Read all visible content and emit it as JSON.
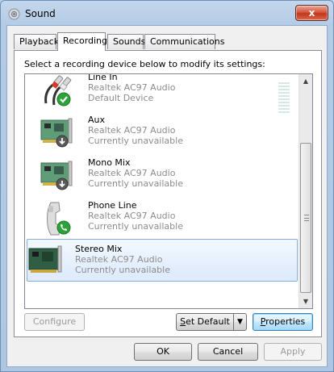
{
  "window": {
    "title": "Sound",
    "close_label": "x"
  },
  "tabs": [
    {
      "label": "Playback",
      "active": false
    },
    {
      "label": "Recording",
      "active": true
    },
    {
      "label": "Sounds",
      "active": false
    },
    {
      "label": "Communications",
      "active": false
    }
  ],
  "panel": {
    "instruction": "Select a recording device below to modify its settings:"
  },
  "devices": [
    {
      "name": "Line In",
      "driver": "Realtek AC97 Audio",
      "status": "Default Device",
      "icon": "line-in-cable-icon",
      "badge": "default-check-icon",
      "selected": false
    },
    {
      "name": "Aux",
      "driver": "Realtek AC97 Audio",
      "status": "Currently unavailable",
      "icon": "sound-card-icon",
      "badge": "unavailable-arrow-icon",
      "selected": false
    },
    {
      "name": "Mono Mix",
      "driver": "Realtek AC97 Audio",
      "status": "Currently unavailable",
      "icon": "sound-card-icon",
      "badge": "unavailable-arrow-icon",
      "selected": false
    },
    {
      "name": "Phone Line",
      "driver": "Realtek AC97 Audio",
      "status": "Currently unavailable",
      "icon": "telephone-handset-icon",
      "badge": "phone-badge-icon",
      "selected": false
    },
    {
      "name": "Stereo Mix",
      "driver": "Realtek AC97 Audio",
      "status": "Currently unavailable",
      "icon": "sound-card-icon",
      "badge": "",
      "selected": true
    }
  ],
  "buttons": {
    "configure": "Configure",
    "set_default_first": "S",
    "set_default_rest": "et Default",
    "set_default_arrow": "▼",
    "properties_first": "P",
    "properties_rest": "roperties",
    "ok": "OK",
    "cancel": "Cancel",
    "apply": "Apply"
  },
  "colors": {
    "selection_border": "#84acdd",
    "default_check": "#2ea23a",
    "disabled_text": "#9b9b9b"
  }
}
